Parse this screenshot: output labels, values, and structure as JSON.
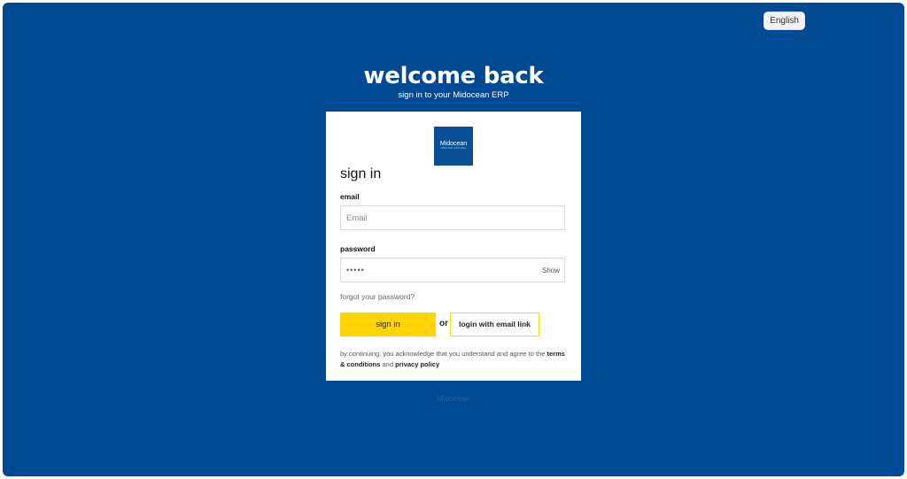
{
  "header": {
    "language_label": "English",
    "title": "welcome back",
    "subtitle": "sign in to your Midocean ERP"
  },
  "card": {
    "logo_text": "Midocean",
    "logo_tagline": "TRUSTED ORIGINAL",
    "heading": "sign in",
    "email": {
      "label": "email",
      "placeholder": "Email"
    },
    "password": {
      "label": "password",
      "masked_value": "•••••",
      "show_label": "Show"
    },
    "forgot_link": "forgot your password?",
    "sign_in_button": "sign in",
    "or_text": "or",
    "email_link_button": "login with email link",
    "legal": {
      "prefix": "by continuing, you acknowledge that you understand and agree to the",
      "terms_link": "terms & conditions",
      "and_text": "and",
      "privacy_link": "privacy policy"
    }
  },
  "footer": {
    "logo_text": "Midocean"
  },
  "colors": {
    "background": "#004a93",
    "accent": "#ffd400",
    "card": "#ffffff"
  }
}
